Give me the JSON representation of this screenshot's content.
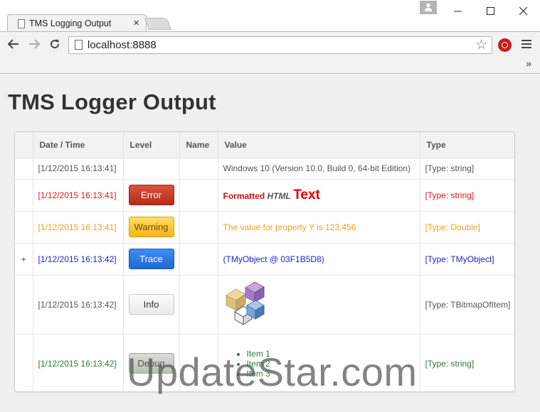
{
  "browser": {
    "tab_title": "TMS Logging Output",
    "tab_close": "×",
    "url": "localhost:8888",
    "bookmarks_more": "»"
  },
  "page": {
    "title": "TMS Logger Output"
  },
  "table": {
    "headers": {
      "datetime": "Date / Time",
      "level": "Level",
      "name": "Name",
      "value": "Value",
      "type": "Type"
    },
    "rows": [
      {
        "expand": "",
        "datetime": "[1/12/2015 16:13:41]",
        "level": "",
        "name": "",
        "value": "Windows 10 (Version 10.0, Build 0, 64-bit Edition)",
        "type": "[Type: string]",
        "color": "#555555"
      },
      {
        "expand": "",
        "datetime": "[1/12/2015 16:13:41]",
        "level": "Error",
        "name": "",
        "value_parts": [
          "Formatted",
          "HTML",
          "Text"
        ],
        "type": "[Type: string]",
        "color": "#e01b1b"
      },
      {
        "expand": "",
        "datetime": "[1/12/2015 16:13:41]",
        "level": "Warning",
        "name": "",
        "value": "The value for property Y is 123,456",
        "type": "[Type: Double]",
        "color": "#f0a020"
      },
      {
        "expand": "+",
        "datetime": "[1/12/2015 16:13:42]",
        "level": "Trace",
        "name": "",
        "value": "(TMyObject @ 03F1B5D8)",
        "type": "[Type: TMyObject]",
        "color": "#2222cc"
      },
      {
        "expand": "",
        "datetime": "[1/12/2015 16:13:42]",
        "level": "Info",
        "name": "",
        "value_image": "cubes-image",
        "type": "[Type: TBitmapOfItem]",
        "color": "#555555"
      },
      {
        "expand": "",
        "datetime": "[1/12/2015 16:13:42]",
        "level": "Debug",
        "name": "",
        "value_list": [
          "Item 1",
          "Item 2",
          "Item 3"
        ],
        "type": "[Type: string]",
        "color": "#2f7a3c"
      }
    ]
  },
  "watermark": "UpdateStar.com"
}
